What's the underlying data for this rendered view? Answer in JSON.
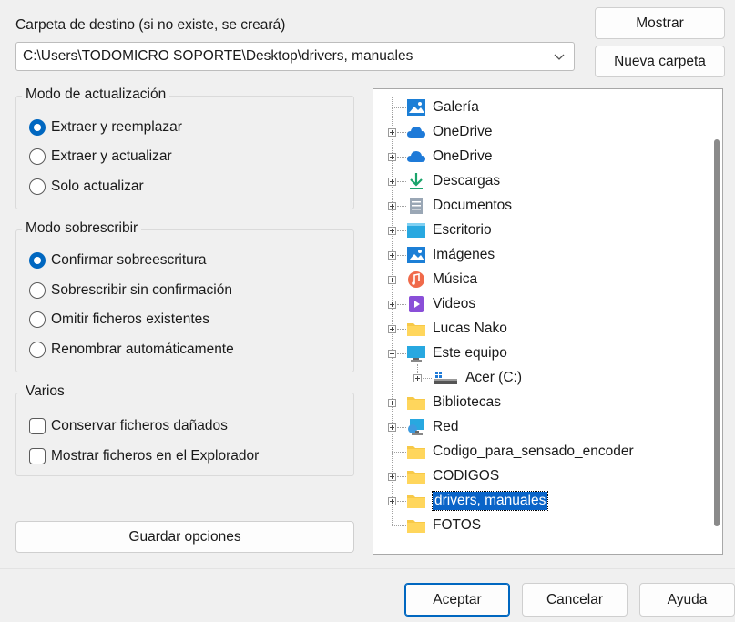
{
  "dest": {
    "label": "Carpeta de destino (si no existe, se creará)",
    "path": "C:\\Users\\TODOMICRO SOPORTE\\Desktop\\drivers, manuales",
    "show_button": "Mostrar",
    "new_folder_button": "Nueva carpeta"
  },
  "update_mode": {
    "title": "Modo de actualización",
    "options": [
      "Extraer y reemplazar",
      "Extraer y actualizar",
      "Solo actualizar"
    ],
    "selected": "Extraer y reemplazar"
  },
  "overwrite_mode": {
    "title": "Modo sobrescribir",
    "options": [
      "Confirmar sobreescritura",
      "Sobrescribir sin confirmación",
      "Omitir ficheros existentes",
      "Renombrar automáticamente"
    ],
    "selected": "Confirmar sobreescritura"
  },
  "misc": {
    "title": "Varios",
    "options": [
      "Conservar ficheros dañados",
      "Mostrar ficheros en el Explorador"
    ]
  },
  "save_options_button": "Guardar opciones",
  "tree": {
    "items": [
      {
        "label": "Galería",
        "icon": "gallery-icon"
      },
      {
        "label": "OneDrive",
        "icon": "onedrive-cloud-icon"
      },
      {
        "label": "OneDrive",
        "icon": "onedrive-cloud-icon"
      },
      {
        "label": "Descargas",
        "icon": "download-arrow-icon"
      },
      {
        "label": "Documentos",
        "icon": "document-icon"
      },
      {
        "label": "Escritorio",
        "icon": "desktop-icon"
      },
      {
        "label": "Imágenes",
        "icon": "pictures-icon"
      },
      {
        "label": "Música",
        "icon": "music-icon"
      },
      {
        "label": "Videos",
        "icon": "video-icon"
      },
      {
        "label": "Lucas Nako",
        "icon": "folder-icon"
      },
      {
        "label": "Este equipo",
        "icon": "computer-icon"
      },
      {
        "label": "Acer (C:)",
        "icon": "drive-icon"
      },
      {
        "label": "Bibliotecas",
        "icon": "folder-icon"
      },
      {
        "label": "Red",
        "icon": "network-icon"
      },
      {
        "label": "Codigo_para_sensado_encoder",
        "icon": "folder-icon"
      },
      {
        "label": "CODIGOS",
        "icon": "folder-icon"
      },
      {
        "label": "drivers, manuales",
        "icon": "folder-icon"
      },
      {
        "label": "FOTOS",
        "icon": "folder-icon"
      }
    ],
    "selected": "drivers, manuales"
  },
  "footer": {
    "accept": "Aceptar",
    "cancel": "Cancelar",
    "help": "Ayuda"
  },
  "colors": {
    "accent": "#0067c0",
    "selection": "#0a64c8",
    "folder": "#f7c948",
    "onedrive": "#1e7ad8"
  }
}
